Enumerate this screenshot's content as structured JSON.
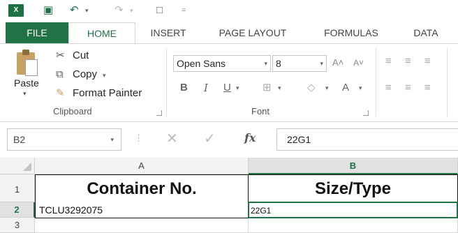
{
  "ribbon_tabs": {
    "file": "FILE",
    "home": "HOME",
    "insert": "INSERT",
    "page_layout": "PAGE LAYOUT",
    "formulas": "FORMULAS",
    "data": "DATA"
  },
  "clipboard": {
    "paste": "Paste",
    "cut": "Cut",
    "copy": "Copy",
    "format_painter": "Format Painter",
    "group_label": "Clipboard"
  },
  "font_group": {
    "font_name": "Open Sans",
    "font_size": "8",
    "group_label": "Font"
  },
  "formula_bar": {
    "name_box": "B2",
    "content": "22G1"
  },
  "sheet": {
    "columns": [
      "A",
      "B"
    ],
    "rows": [
      "1",
      "2",
      "3"
    ],
    "a1": "Container No.",
    "b1": "Size/Type",
    "a2": "TCLU3292075",
    "b2": "22G1"
  },
  "colors": {
    "excel_green": "#217346"
  }
}
